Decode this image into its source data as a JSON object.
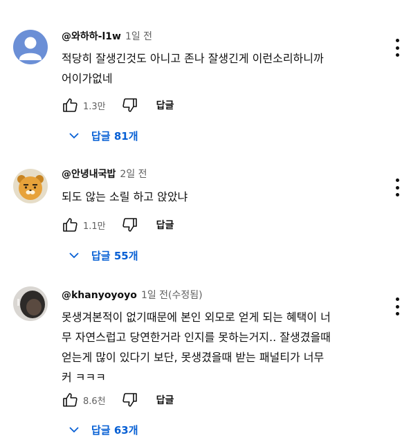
{
  "comments": [
    {
      "handle": "@와하하-l1w",
      "time": "1일 전",
      "text": "적당히 잘생긴것도 아니고 존나 잘생긴게 이런소리하니까\n어이가없네",
      "likes": "1.3만",
      "reply_label": "답글",
      "replies_label": "답글 81개",
      "avatar": "default-person-avatar",
      "avatar_color": "#6b8fd6"
    },
    {
      "handle": "@안녕내국밥",
      "time": "2일 전",
      "text": "되도 않는  소릴  하고  앉았냐",
      "likes": "1.1만",
      "reply_label": "답글",
      "replies_label": "답글 55개",
      "avatar": "cartoon-lion-avatar",
      "avatar_color": "#e7a23a"
    },
    {
      "handle": "@khanyoyoyo",
      "time": "1일 전(수정됨)",
      "text": "못생겨본적이 없기때문에 본인 외모로 얻게 되는 혜택이 너\n무 자연스럽고 당연한거라 인지를 못하는거지.. 잘생겼을때\n얻는게 많이 있다기 보단, 못생겼을때 받는 패널티가 너무\n커 ㅋㅋㅋ",
      "likes": "8.6천",
      "reply_label": "답글",
      "replies_label": "답글 63개",
      "avatar": "dark-photo-avatar",
      "avatar_color": "#3a3a3a"
    }
  ],
  "colors": {
    "link": "#065fd4",
    "secondary": "#606060",
    "text": "#0f0f0f"
  }
}
